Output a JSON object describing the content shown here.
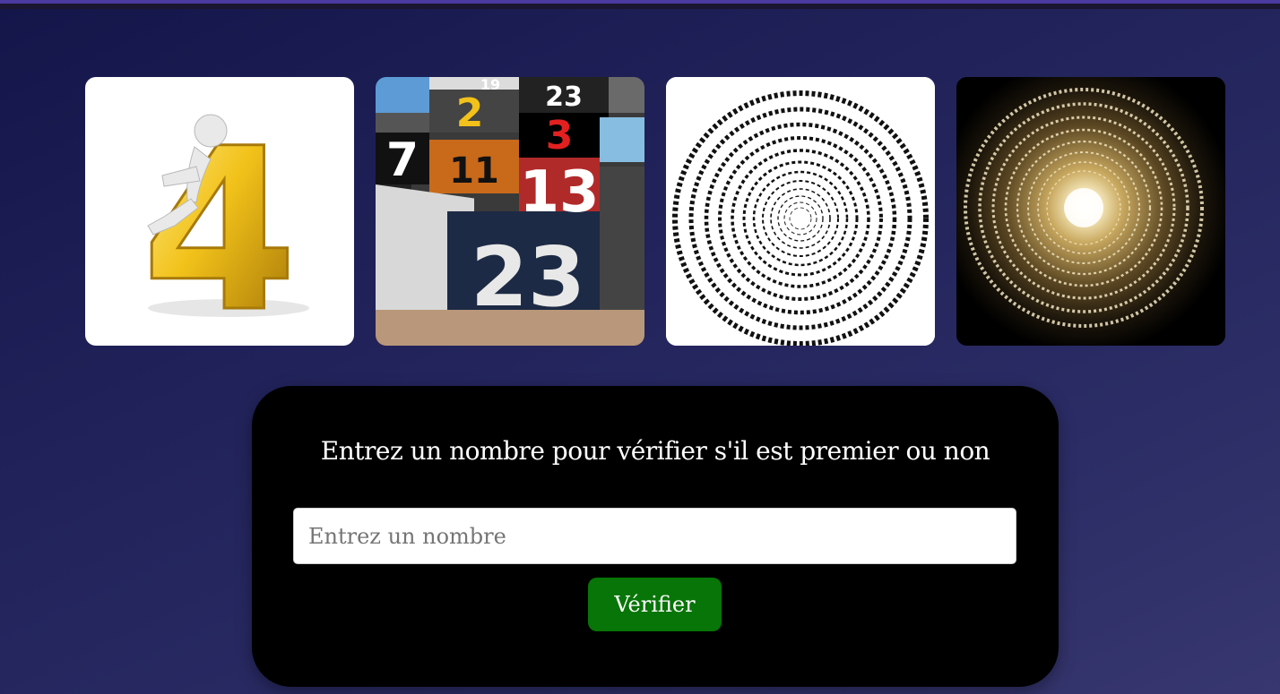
{
  "gallery": {
    "tiles": [
      {
        "name": "number-four-image",
        "alt_text": "4"
      },
      {
        "name": "numbered-squares-image",
        "numbers": [
          "19",
          "23",
          "2",
          "3",
          "7",
          "11",
          "13",
          "23"
        ]
      },
      {
        "name": "spiral-numbers-image"
      },
      {
        "name": "golden-spiral-numbers-image"
      }
    ]
  },
  "form": {
    "title": "Entrez un nombre pour vérifier s'il est premier ou non",
    "input_placeholder": "Entrez un nombre",
    "input_value": "",
    "button_label": "Vérifier"
  },
  "colors": {
    "card_bg": "#000000",
    "button_bg": "#077507",
    "top_accent": "#4b3aa0"
  }
}
